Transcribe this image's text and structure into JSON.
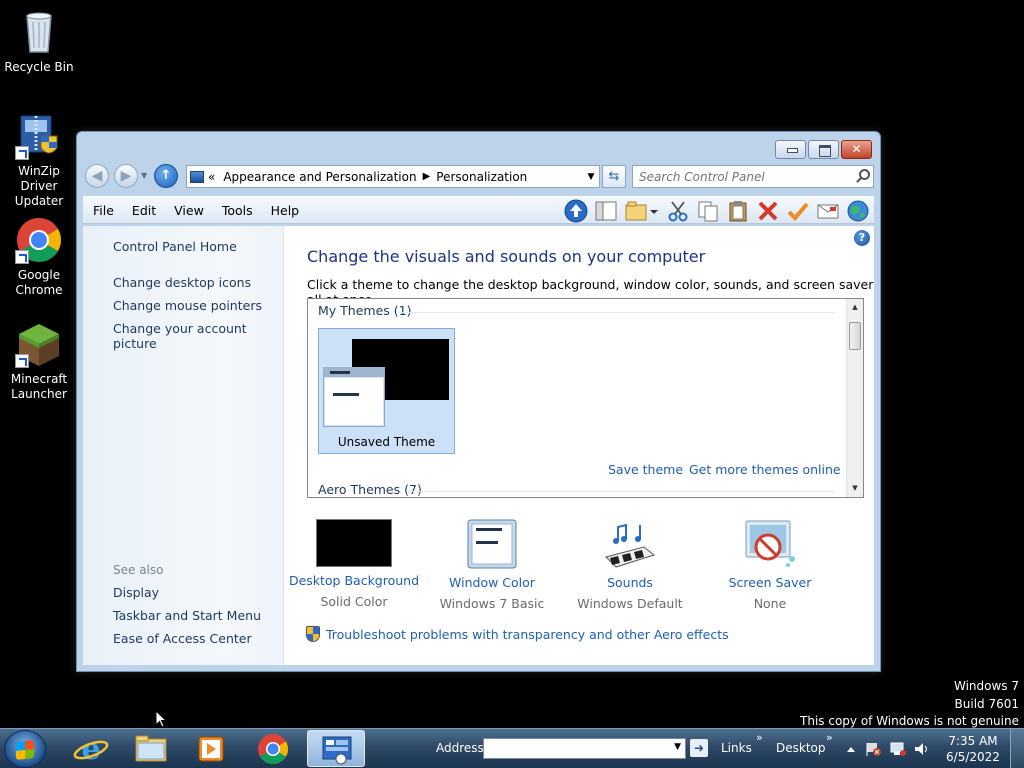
{
  "desktop": {
    "icons": [
      {
        "label": "Recycle Bin"
      },
      {
        "label": "WinZip Driver Updater"
      },
      {
        "label": "Google Chrome"
      },
      {
        "label": "Minecraft Launcher"
      }
    ]
  },
  "window": {
    "breadcrumb": {
      "prefix": "«",
      "items": [
        "Appearance and Personalization",
        "Personalization"
      ]
    },
    "search_placeholder": "Search Control Panel",
    "menu": [
      "File",
      "Edit",
      "View",
      "Tools",
      "Help"
    ],
    "left_pane": {
      "home": "Control Panel Home",
      "links": [
        "Change desktop icons",
        "Change mouse pointers",
        "Change your account picture"
      ],
      "see_also": "See also",
      "see_also_links": [
        "Display",
        "Taskbar and Start Menu",
        "Ease of Access Center"
      ]
    },
    "main": {
      "title": "Change the visuals and sounds on your computer",
      "subtitle": "Click a theme to change the desktop background, window color, sounds, and screen saver all at once.",
      "my_themes": "My Themes (1)",
      "unsaved_theme": "Unsaved Theme",
      "save_theme": "Save theme",
      "get_more": "Get more themes online",
      "aero_themes": "Aero Themes (7)",
      "options": [
        {
          "title": "Desktop Background",
          "value": "Solid Color"
        },
        {
          "title": "Window Color",
          "value": "Windows 7 Basic"
        },
        {
          "title": "Sounds",
          "value": "Windows Default"
        },
        {
          "title": "Screen Saver",
          "value": "None"
        }
      ],
      "troubleshoot": "Troubleshoot problems with transparency and other Aero effects"
    }
  },
  "watermark": {
    "line1": "Windows 7",
    "line2": "Build 7601",
    "line3": "This copy of Windows is not genuine"
  },
  "taskbar": {
    "address_label": "Address",
    "links": "Links",
    "desktop": "Desktop",
    "time": "7:35 AM",
    "date": "6/5/2022"
  },
  "colors": {
    "link": "#1e5fb0",
    "title": "#1e3287",
    "desktop_bg": "#000000"
  }
}
